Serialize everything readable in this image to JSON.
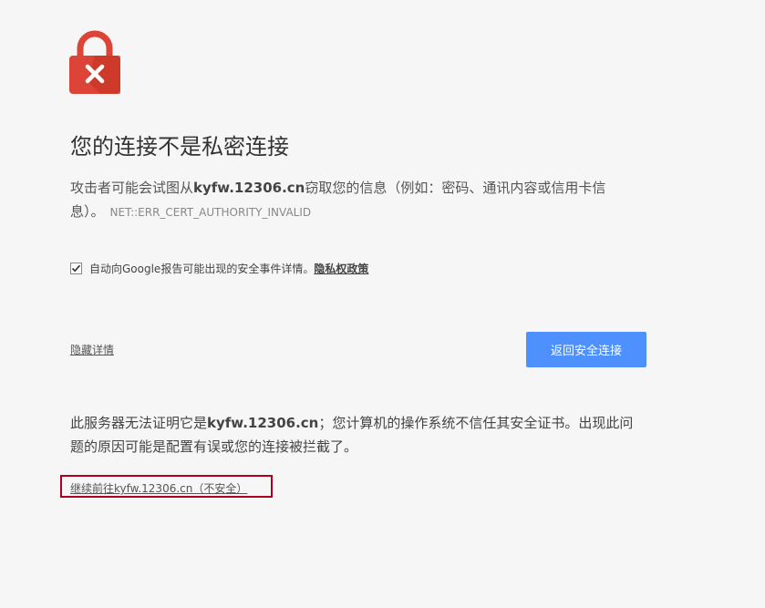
{
  "interstitial": {
    "heading": "您的连接不是私密连接",
    "explanation_prefix": "攻击者可能会试图从",
    "host": "kyfw.12306.cn",
    "explanation_suffix": "窃取您的信息（例如：密码、通讯内容或信用卡信息）。",
    "error_code": "NET::ERR_CERT_AUTHORITY_INVALID",
    "report": {
      "checked": true,
      "label": "自动向Google报告可能出现的安全事件详情。",
      "privacy_link": "隐私权政策"
    },
    "hide_details": "隐藏详情",
    "back_button": "返回安全连接",
    "details_prefix": "此服务器无法证明它是",
    "details_host": "kyfw.12306.cn",
    "details_suffix": "；您计算机的操作系统不信任其安全证书。出现此问题的原因可能是配置有误或您的连接被拦截了。",
    "proceed_link": "继续前往kyfw.12306.cn（不安全）"
  },
  "colors": {
    "background": "#f6f6f6",
    "lock": "#db4437",
    "primary_button": "#4d90fe",
    "highlight_box": "#b00020"
  },
  "icons": {
    "lock": "red-lock-with-x-icon",
    "checkbox": "checkmark-icon"
  }
}
